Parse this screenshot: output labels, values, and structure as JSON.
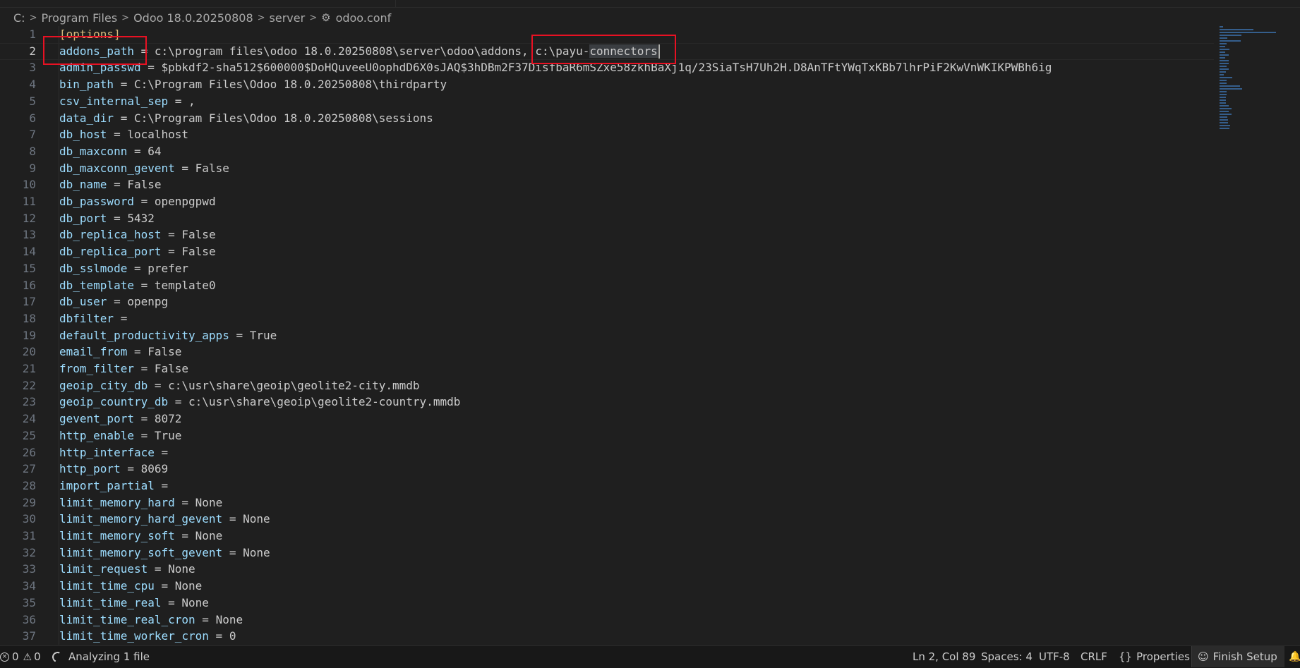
{
  "breadcrumb": {
    "items": [
      "C:",
      "Program Files",
      "Odoo 18.0.20250808",
      "server"
    ],
    "file": "odoo.conf",
    "separator": ">",
    "file_icon": "gear-icon"
  },
  "editor": {
    "current_line": 2,
    "lines": [
      {
        "n": "1",
        "section": "[options]"
      },
      {
        "n": "2",
        "key": "addons_path",
        "eq": " = ",
        "pre": "c:\\program files\\odoo 18.0.20250808\\server\\odoo\\addons, c:\\payu-",
        "sel": "connectors"
      },
      {
        "n": "3",
        "key": "admin_passwd",
        "eq": " = ",
        "val": "$pbkdf2-sha512$600000$DoHQuveeU0ophdD6X0sJAQ$3hDBm2F37DisfbaR6mSZxe58zkhBaXj1q/23SiaTsH7Uh2H.D8AnTFtYWqTxKBb7lhrPiF2KwVnWKIKPWBh6ig"
      },
      {
        "n": "4",
        "key": "bin_path",
        "eq": " = ",
        "val": "C:\\Program Files\\Odoo 18.0.20250808\\thirdparty"
      },
      {
        "n": "5",
        "key": "csv_internal_sep",
        "eq": " = ",
        "val": ","
      },
      {
        "n": "6",
        "key": "data_dir",
        "eq": " = ",
        "val": "C:\\Program Files\\Odoo 18.0.20250808\\sessions"
      },
      {
        "n": "7",
        "key": "db_host",
        "eq": " = ",
        "val": "localhost"
      },
      {
        "n": "8",
        "key": "db_maxconn",
        "eq": " = ",
        "val": "64"
      },
      {
        "n": "9",
        "key": "db_maxconn_gevent",
        "eq": " = ",
        "val": "False"
      },
      {
        "n": "10",
        "key": "db_name",
        "eq": " = ",
        "val": "False"
      },
      {
        "n": "11",
        "key": "db_password",
        "eq": " = ",
        "val": "openpgpwd"
      },
      {
        "n": "12",
        "key": "db_port",
        "eq": " = ",
        "val": "5432"
      },
      {
        "n": "13",
        "key": "db_replica_host",
        "eq": " = ",
        "val": "False"
      },
      {
        "n": "14",
        "key": "db_replica_port",
        "eq": " = ",
        "val": "False"
      },
      {
        "n": "15",
        "key": "db_sslmode",
        "eq": " = ",
        "val": "prefer"
      },
      {
        "n": "16",
        "key": "db_template",
        "eq": " = ",
        "val": "template0"
      },
      {
        "n": "17",
        "key": "db_user",
        "eq": " = ",
        "val": "openpg"
      },
      {
        "n": "18",
        "key": "dbfilter",
        "eq": " =",
        "val": ""
      },
      {
        "n": "19",
        "key": "default_productivity_apps",
        "eq": " = ",
        "val": "True"
      },
      {
        "n": "20",
        "key": "email_from",
        "eq": " = ",
        "val": "False"
      },
      {
        "n": "21",
        "key": "from_filter",
        "eq": " = ",
        "val": "False"
      },
      {
        "n": "22",
        "key": "geoip_city_db",
        "eq": " = ",
        "val": "c:\\usr\\share\\geoip\\geolite2-city.mmdb"
      },
      {
        "n": "23",
        "key": "geoip_country_db",
        "eq": " = ",
        "val": "c:\\usr\\share\\geoip\\geolite2-country.mmdb"
      },
      {
        "n": "24",
        "key": "gevent_port",
        "eq": " = ",
        "val": "8072"
      },
      {
        "n": "25",
        "key": "http_enable",
        "eq": " = ",
        "val": "True"
      },
      {
        "n": "26",
        "key": "http_interface",
        "eq": " =",
        "val": ""
      },
      {
        "n": "27",
        "key": "http_port",
        "eq": " = ",
        "val": "8069"
      },
      {
        "n": "28",
        "key": "import_partial",
        "eq": " =",
        "val": ""
      },
      {
        "n": "29",
        "key": "limit_memory_hard",
        "eq": " = ",
        "val": "None"
      },
      {
        "n": "30",
        "key": "limit_memory_hard_gevent",
        "eq": " = ",
        "val": "None"
      },
      {
        "n": "31",
        "key": "limit_memory_soft",
        "eq": " = ",
        "val": "None"
      },
      {
        "n": "32",
        "key": "limit_memory_soft_gevent",
        "eq": " = ",
        "val": "None"
      },
      {
        "n": "33",
        "key": "limit_request",
        "eq": " = ",
        "val": "None"
      },
      {
        "n": "34",
        "key": "limit_time_cpu",
        "eq": " = ",
        "val": "None"
      },
      {
        "n": "35",
        "key": "limit_time_real",
        "eq": " = ",
        "val": "None"
      },
      {
        "n": "36",
        "key": "limit_time_real_cron",
        "eq": " = ",
        "val": "None"
      },
      {
        "n": "37",
        "key": "limit_time_worker_cron",
        "eq": " = ",
        "val": "0"
      }
    ]
  },
  "statusbar": {
    "errors": "0",
    "warnings": "0",
    "analyzing": "Analyzing 1 file",
    "position": "Ln 2, Col 89",
    "spaces": "Spaces: 4",
    "encoding": "UTF-8",
    "eol": "CRLF",
    "language": "Properties",
    "finish_setup": "Finish Setup"
  },
  "colors": {
    "background": "#1f1f1f",
    "key": "#9cdcfe",
    "section": "#d7ba7d",
    "annotation_box": "#e81123"
  }
}
